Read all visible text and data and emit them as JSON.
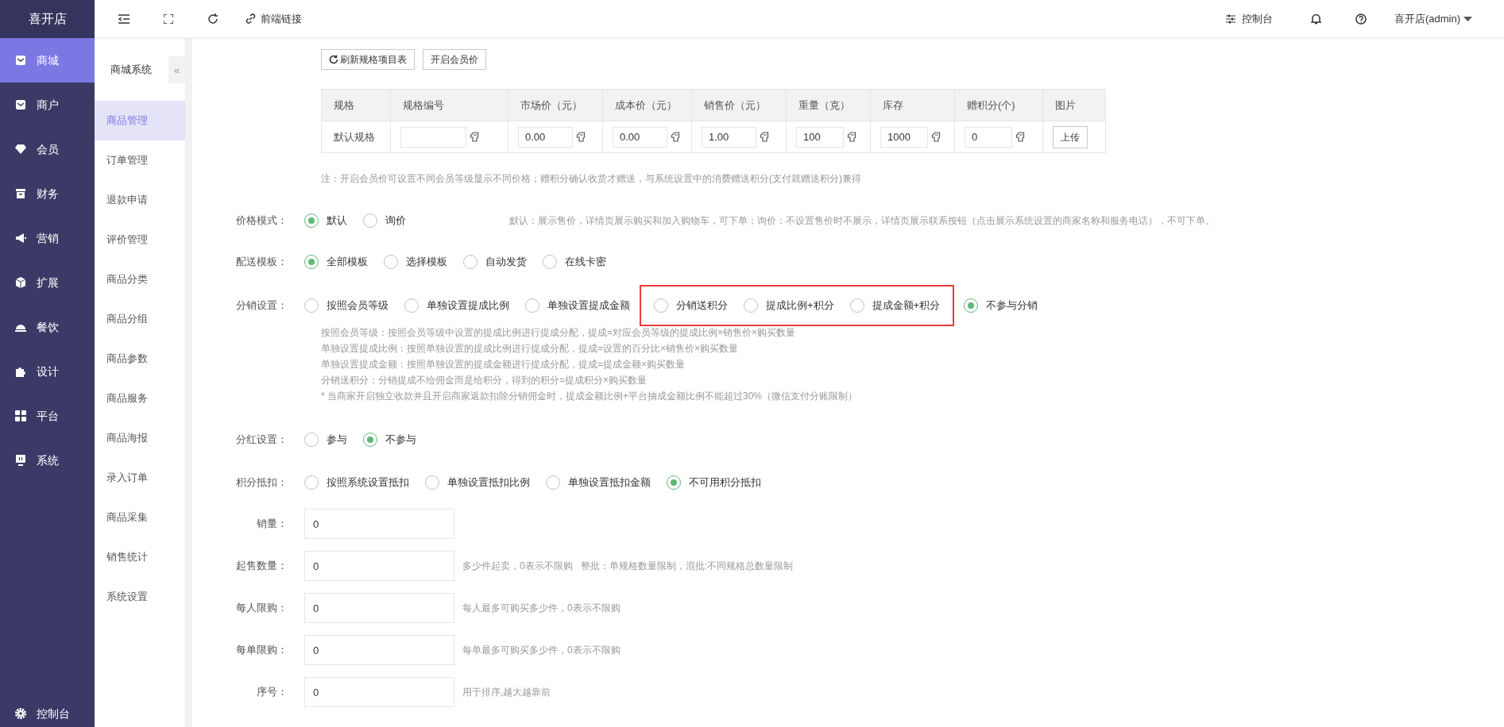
{
  "app": {
    "logo": "喜开店"
  },
  "nav": [
    {
      "label": "商城",
      "selected": true
    },
    {
      "label": "商户",
      "selected": false
    },
    {
      "label": "会员",
      "selected": false
    },
    {
      "label": "财务",
      "selected": false
    },
    {
      "label": "营销",
      "selected": false
    },
    {
      "label": "扩展",
      "selected": false
    },
    {
      "label": "餐饮",
      "selected": false
    },
    {
      "label": "设计",
      "selected": false
    },
    {
      "label": "平台",
      "selected": false
    },
    {
      "label": "系统",
      "selected": false
    }
  ],
  "nav_footer": {
    "label": "控制台"
  },
  "topbar": {
    "link": "前端链接",
    "console": "控制台",
    "user": "喜开店(admin)"
  },
  "subnav": {
    "title": "商城系统",
    "collapse": "«",
    "items": [
      {
        "label": "商品管理",
        "selected": true
      },
      {
        "label": "订单管理",
        "selected": false
      },
      {
        "label": "退款申请",
        "selected": false
      },
      {
        "label": "评价管理",
        "selected": false
      },
      {
        "label": "商品分类",
        "selected": false
      },
      {
        "label": "商品分组",
        "selected": false
      },
      {
        "label": "商品参数",
        "selected": false
      },
      {
        "label": "商品服务",
        "selected": false
      },
      {
        "label": "商品海报",
        "selected": false
      },
      {
        "label": "录入订单",
        "selected": false
      },
      {
        "label": "商品采集",
        "selected": false
      },
      {
        "label": "销售统计",
        "selected": false
      },
      {
        "label": "系统设置",
        "selected": false
      }
    ]
  },
  "form": {
    "buttons": [
      {
        "label": "刷新规格项目表",
        "kind": "refresh"
      },
      {
        "label": "开启会员价",
        "kind": "plain"
      }
    ],
    "spec_table": {
      "columns": [
        "规格",
        "规格编号",
        "市场价（元）",
        "成本价（元）",
        "销售价（元）",
        "重量（克）",
        "库存",
        "赠积分(个)",
        "图片"
      ],
      "rows": [
        {
          "cells": [
            {
              "kind": "text",
              "value": "默认规格"
            },
            {
              "kind": "input"
            },
            {
              "kind": "input",
              "value": "0.00"
            },
            {
              "kind": "input",
              "value": "0.00"
            },
            {
              "kind": "input",
              "value": "1.00"
            },
            {
              "kind": "input",
              "value": "100"
            },
            {
              "kind": "input",
              "value": "1000"
            },
            {
              "kind": "input",
              "value": "0"
            },
            {
              "kind": "upload",
              "value": "上传"
            }
          ]
        }
      ]
    },
    "note": "注：开启会员价可设置不同会员等级显示不同价格；赠积分确认收货才赠送，与系统设置中的消费赠送积分(支付就赠送积分)兼得",
    "radio_groups": [
      {
        "label": "价格模式：",
        "options": [
          {
            "label": "默认",
            "selected": true,
            "highlighted": false
          },
          {
            "label": "询价",
            "selected": false,
            "highlighted": false
          }
        ],
        "hint": "默认：展示售价，详情页展示购买和加入购物车，可下单；询价：不设置售价时不展示，详情页展示联系按钮（点击展示系统设置的商家名称和服务电话），不可下单。"
      },
      {
        "label": "配送模板：",
        "options": [
          {
            "label": "全部模板",
            "selected": true,
            "highlighted": false
          },
          {
            "label": "选择模板",
            "selected": false,
            "highlighted": false
          },
          {
            "label": "自动发货",
            "selected": false,
            "highlighted": false
          },
          {
            "label": "在线卡密",
            "selected": false,
            "highlighted": false
          }
        ]
      },
      {
        "label": "分销设置：",
        "options": [
          {
            "label": "按照会员等级",
            "selected": false,
            "highlighted": false
          },
          {
            "label": "单独设置提成比例",
            "selected": false,
            "highlighted": false
          },
          {
            "label": "单独设置提成金额",
            "selected": false,
            "highlighted": false
          },
          {
            "label": "分销送积分",
            "selected": false,
            "highlighted": true
          },
          {
            "label": "提成比例+积分",
            "selected": false,
            "highlighted": true
          },
          {
            "label": "提成金额+积分",
            "selected": false,
            "highlighted": true
          },
          {
            "label": "不参与分销",
            "selected": true,
            "highlighted": false
          }
        ],
        "notes": [
          "按照会员等级：按照会员等级中设置的提成比例进行提成分配，提成=对应会员等级的提成比例×销售价×购买数量",
          "单独设置提成比例：按照单独设置的提成比例进行提成分配，提成=设置的百分比×销售价×购买数量",
          "单独设置提成金额：按照单独设置的提成金额进行提成分配，提成=提成金额×购买数量",
          "分销送积分：分销提成不给佣金而是给积分，得到的积分=提成积分×购买数量",
          "* 当商家开启独立收款并且开启商家返款扣除分销佣金时，提成金额比例+平台抽成金额比例不能超过30%（微信支付分账限制）"
        ]
      },
      {
        "label": "分红设置：",
        "options": [
          {
            "label": "参与",
            "selected": false,
            "highlighted": false
          },
          {
            "label": "不参与",
            "selected": true,
            "highlighted": false
          }
        ]
      },
      {
        "label": "积分抵扣：",
        "options": [
          {
            "label": "按照系统设置抵扣",
            "selected": false,
            "highlighted": false
          },
          {
            "label": "单独设置抵扣比例",
            "selected": false,
            "highlighted": false
          },
          {
            "label": "单独设置抵扣金额",
            "selected": false,
            "highlighted": false
          },
          {
            "label": "不可用积分抵扣",
            "selected": true,
            "highlighted": false
          }
        ]
      }
    ],
    "fields": [
      {
        "label": "销量：",
        "value": "0"
      },
      {
        "label": "起售数量：",
        "value": "0",
        "hint": "多少件起卖，0表示不限购   整批：单规格数量限制，混批:不同规格总数量限制"
      },
      {
        "label": "每人限购：",
        "value": "0",
        "hint": "每人最多可购买多少件，0表示不限购"
      },
      {
        "label": "每单限购：",
        "value": "0",
        "hint": "每单最多可购买多少件，0表示不限购"
      },
      {
        "label": "序号：",
        "value": "0",
        "hint": "用于排序,越大越靠前"
      }
    ]
  }
}
